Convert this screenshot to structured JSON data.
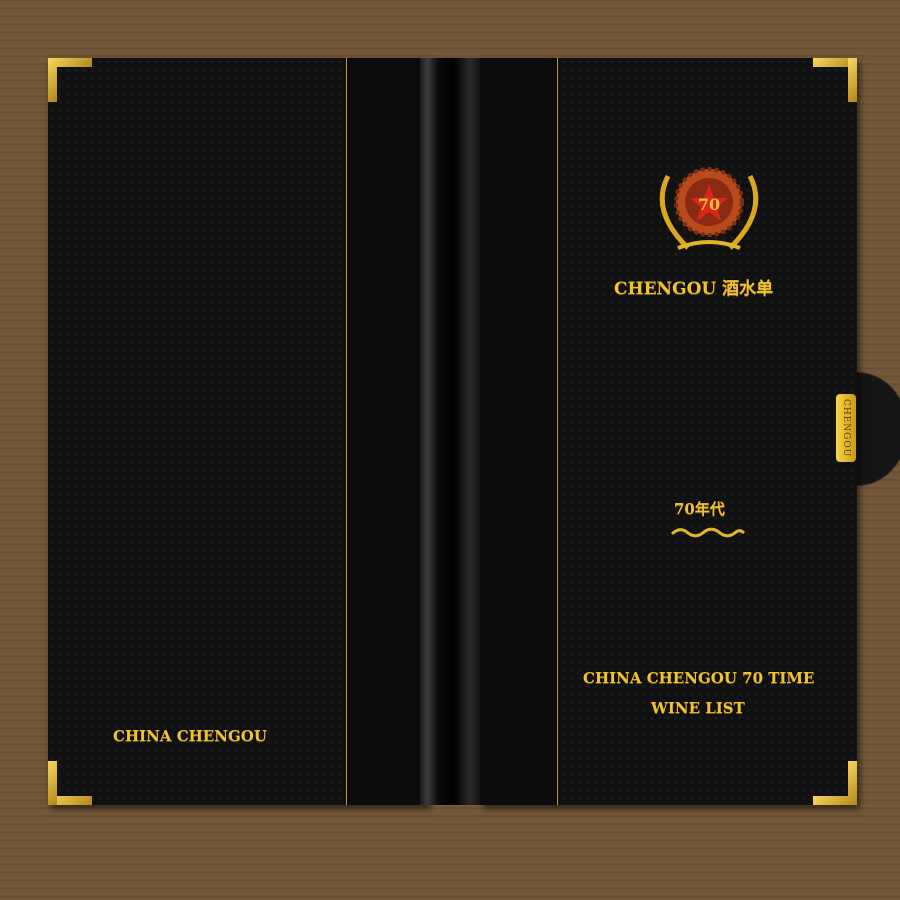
{
  "left_cover": {
    "brand_text": "CHINA CHENGOU"
  },
  "right_cover": {
    "logo": {
      "badge_number": "70",
      "icon": "bottle-cap-laurel-emblem-icon"
    },
    "title": "CHENGOU 酒水单",
    "era": "70年代",
    "subtitle_line1": "CHINA CHENGOU 70 TIME",
    "subtitle_line2": "WINE LIST",
    "tab_label": "CHENGOU"
  },
  "colors": {
    "gold": "#f1c232",
    "cover": "#111111",
    "background": "#6f5436"
  }
}
